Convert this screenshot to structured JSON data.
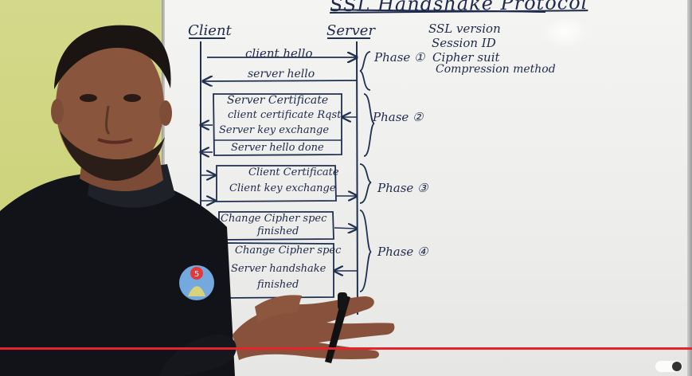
{
  "board": {
    "title": "SSL Handshake Protocol",
    "labels": {
      "client": "Client",
      "server": "Server"
    },
    "messages": [
      "client hello",
      "server hello",
      "Server Certificate",
      "client certificate Rqst",
      "Server key exchange",
      "Server hello done",
      "Client Certificate",
      "Client key exchange",
      "Change Cipher spec",
      "finished",
      "Change Cipher spec",
      "Server handshake",
      "finished"
    ],
    "phases": [
      "Phase ①",
      "Phase ②",
      "Phase ③",
      "Phase ④"
    ],
    "bullets": [
      "SSL version",
      "Session ID",
      "Cipher suit",
      "Compression method"
    ],
    "badge": "5"
  },
  "video": {
    "progress_color": "#e5252b"
  }
}
